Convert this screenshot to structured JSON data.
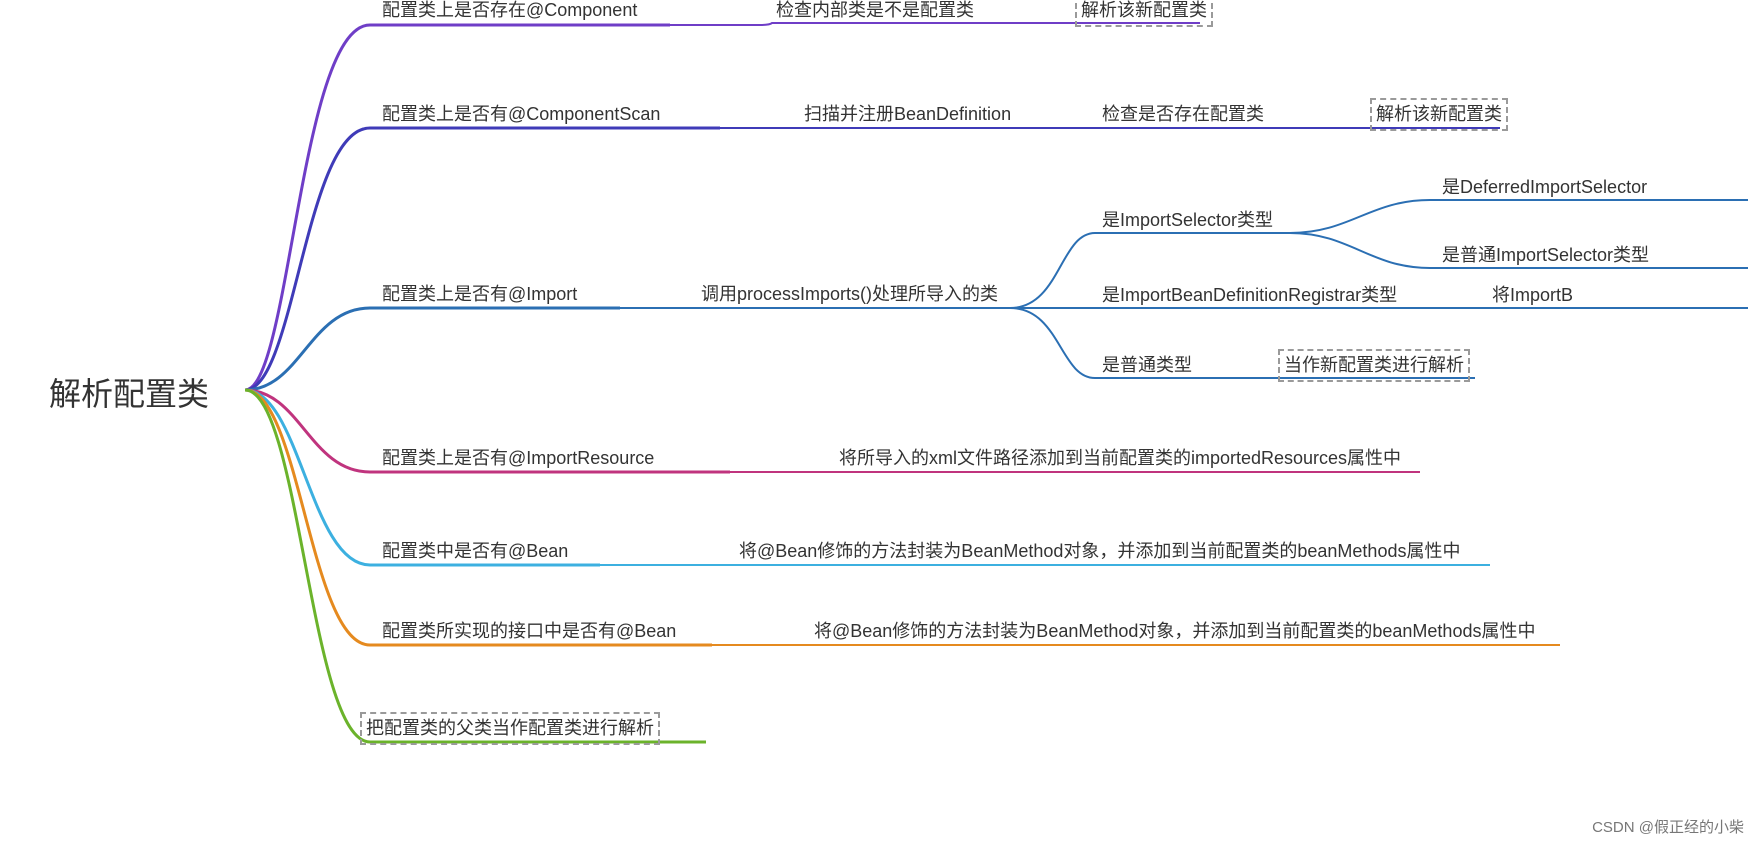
{
  "root": {
    "label": "解析配置类"
  },
  "branches": {
    "b1": {
      "label": "配置类上是否存在@Component",
      "children": {
        "c1": {
          "label": "检查内部类是不是配置类"
        },
        "c2": {
          "label": "解析该新配置类"
        }
      }
    },
    "b2": {
      "label": "配置类上是否有@ComponentScan",
      "children": {
        "c1": {
          "label": "扫描并注册BeanDefinition"
        },
        "c2": {
          "label": "检查是否存在配置类"
        },
        "c3": {
          "label": "解析该新配置类"
        }
      }
    },
    "b3": {
      "label": "配置类上是否有@Import",
      "children": {
        "c1": {
          "label": "调用processImports()处理所导入的类"
        },
        "sub1": {
          "label": "是ImportSelector类型",
          "children": {
            "d1": {
              "label": "是DeferredImportSelector"
            },
            "d2": {
              "label": "是普通ImportSelector类型"
            }
          }
        },
        "sub2": {
          "label": "是ImportBeanDefinitionRegistrar类型",
          "children": {
            "d1": {
              "label": "将ImportB"
            }
          }
        },
        "sub3": {
          "label": "是普通类型",
          "children": {
            "d1": {
              "label": "当作新配置类进行解析"
            }
          }
        }
      }
    },
    "b4": {
      "label": "配置类上是否有@ImportResource",
      "children": {
        "c1": {
          "label": "将所导入的xml文件路径添加到当前配置类的importedResources属性中"
        }
      }
    },
    "b5": {
      "label": "配置类中是否有@Bean",
      "children": {
        "c1": {
          "label": "将@Bean修饰的方法封装为BeanMethod对象，并添加到当前配置类的beanMethods属性中"
        }
      }
    },
    "b6": {
      "label": "配置类所实现的接口中是否有@Bean",
      "children": {
        "c1": {
          "label": "将@Bean修饰的方法封装为BeanMethod对象，并添加到当前配置类的beanMethods属性中"
        }
      }
    },
    "b7": {
      "label": "把配置类的父类当作配置类进行解析"
    }
  },
  "watermark": "CSDN @假正经的小柴",
  "colors": {
    "b1": "#6f3ec7",
    "b2": "#3f3bb8",
    "b3": "#2b6fb3",
    "b4": "#c0347e",
    "b5": "#3cb0e0",
    "b6": "#e58a1f",
    "b7": "#6bb32b"
  }
}
